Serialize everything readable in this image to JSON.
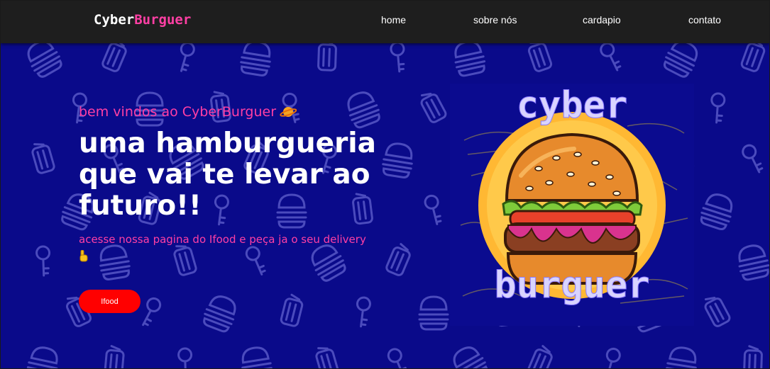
{
  "navbar": {
    "logo_prefix": "Cyber",
    "logo_accent": "Burguer",
    "links": [
      "home",
      "sobre nós",
      "cardapio",
      "contato"
    ]
  },
  "hero": {
    "welcome": "bem vindos ao CyberBurguer",
    "headline_lines": [
      "uma hamburgueria",
      "que vai te levar ao",
      "futuro!!"
    ],
    "subtitle": "acesse nossa pagina do Ifood e peça ja o seu delivery",
    "button_label": "Ifood"
  },
  "logo_image": {
    "line1": "cyber",
    "line2": "burguer"
  },
  "colors": {
    "background": "#0a0a8a",
    "navbar": "#1e1e1e",
    "accent": "#ff3fa4",
    "button": "#ff0000"
  },
  "icons": {
    "welcome_emoji": "planet-icon",
    "subtitle_emoji": "pointing-down-hand-icon"
  }
}
